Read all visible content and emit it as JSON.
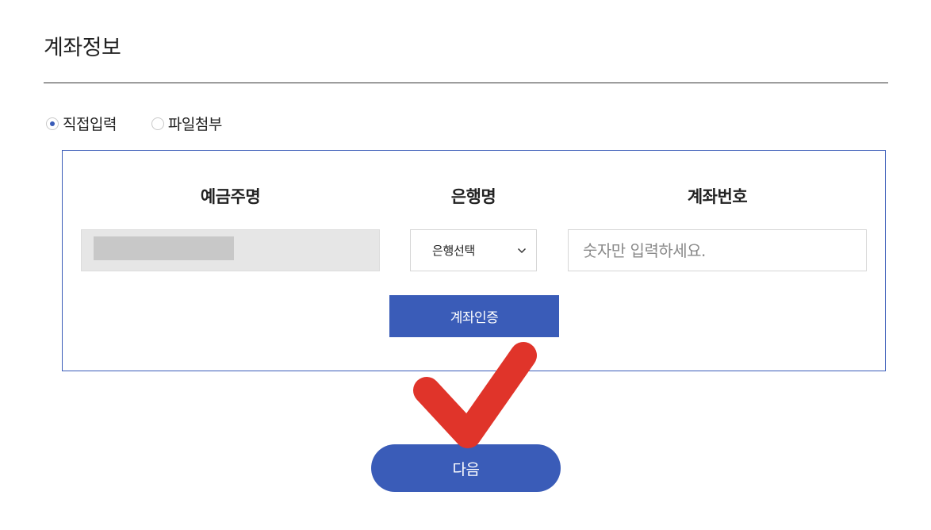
{
  "section": {
    "title": "계좌정보"
  },
  "input_mode": {
    "options": [
      {
        "label": "직접입력",
        "selected": true
      },
      {
        "label": "파일첨부",
        "selected": false
      }
    ]
  },
  "account_form": {
    "columns": {
      "holder_label": "예금주명",
      "bank_label": "은행명",
      "account_label": "계좌번호"
    },
    "holder_value": "",
    "bank_select": {
      "selected": "은행선택",
      "icon": "chevron-down-icon"
    },
    "account_input": {
      "value": "",
      "placeholder": "숫자만 입력하세요."
    },
    "verify_button_label": "계좌인증"
  },
  "next_button_label": "다음",
  "annotation": {
    "icon": "checkmark-icon",
    "color": "#e0342a"
  },
  "colors": {
    "accent": "#3a5cb8",
    "border": "#3a5cb8",
    "masked_field": "#e6e6e6",
    "checkmark": "#e0342a"
  }
}
